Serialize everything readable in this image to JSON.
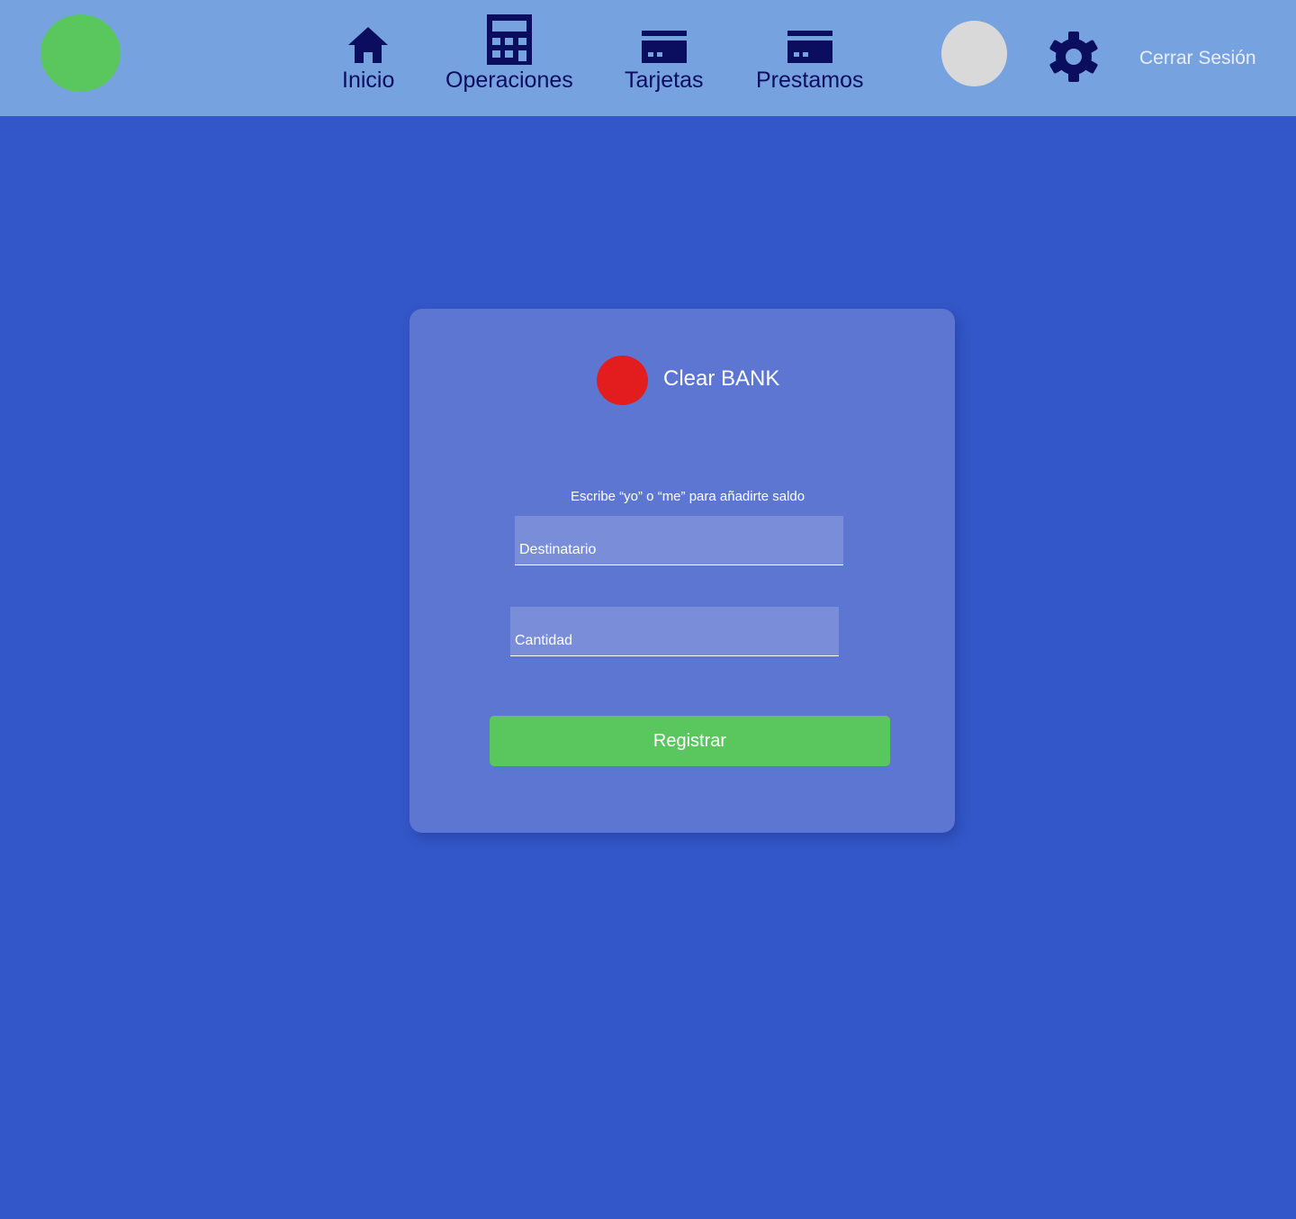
{
  "header": {
    "nav": [
      {
        "label": "Inicio",
        "icon": "home-icon"
      },
      {
        "label": "Operaciones",
        "icon": "calculator-icon"
      },
      {
        "label": "Tarjetas",
        "icon": "credit-card-icon"
      },
      {
        "label": "Prestamos",
        "icon": "credit-card-icon"
      }
    ],
    "settings_icon": "gear-icon",
    "logout_label": "Cerrar Sesión"
  },
  "colors": {
    "background": "#3357c8",
    "topbar": "#77a2e0",
    "nav_text": "#0b0d5e",
    "card": "#5c76d1",
    "input": "#7a8dd9",
    "accent_green": "#5ac75e",
    "brand_red": "#e31d1d",
    "avatar_gray": "#d9d9d9"
  },
  "form": {
    "brand_name": "Clear BANK",
    "hint": "Escribe “yo” o “me” para añadirte saldo",
    "recipient_placeholder": "Destinatario",
    "amount_placeholder": "Cantidad",
    "submit_label": "Registrar"
  }
}
